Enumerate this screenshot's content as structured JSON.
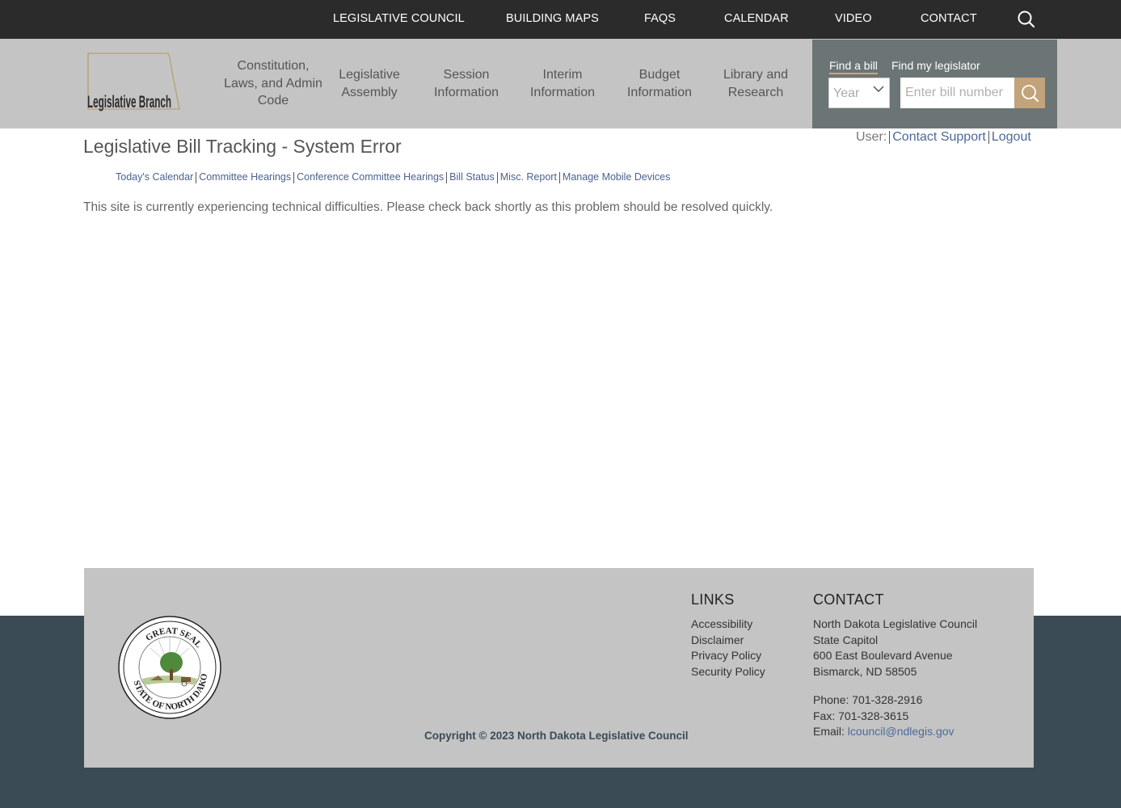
{
  "top_nav": {
    "items": [
      "LEGISLATIVE COUNCIL",
      "BUILDING MAPS",
      "FAQS",
      "CALENDAR",
      "VIDEO",
      "CONTACT"
    ],
    "search_icon": "search-icon"
  },
  "header": {
    "logo_text": "Legislative Branch",
    "main_nav": [
      {
        "line1": "Constitution,",
        "line2": "Laws, and Admin",
        "line3": "Code"
      },
      {
        "line1": "Legislative",
        "line2": "Assembly"
      },
      {
        "line1": "Session",
        "line2": "Information"
      },
      {
        "line1": "Interim",
        "line2": "Information"
      },
      {
        "line1": "Budget",
        "line2": "Information"
      },
      {
        "line1": "Library and",
        "line2": "Research"
      }
    ],
    "find_panel": {
      "tab_bill": "Find a bill",
      "tab_legislator": "Find my legislator",
      "year_value": "Year",
      "bill_placeholder": "Enter bill number",
      "accent": "#c2a37a"
    }
  },
  "page": {
    "title": "Legislative Bill Tracking - System Error",
    "user_label": "User:",
    "contact_support": "Contact Support",
    "logout": "Logout",
    "subnav": [
      "Today's Calendar",
      "Committee Hearings",
      "Conference Committee Hearings",
      "Bill Status",
      "Misc. Report",
      "Manage Mobile Devices"
    ],
    "error_message": "This site is currently experiencing technical difficulties. Please check back shortly as this problem should be resolved quickly."
  },
  "footer": {
    "seal_label": "great-seal-of-north-dakota",
    "copyright": "Copyright © 2023 North Dakota Legislative Council",
    "links_title": "LINKS",
    "links": [
      "Accessibility",
      "Disclaimer",
      "Privacy Policy",
      "Security Policy"
    ],
    "contact_title": "CONTACT",
    "address": [
      "North Dakota Legislative Council",
      "State Capitol",
      "600 East Boulevard Avenue",
      "Bismarck, ND  58505"
    ],
    "phone": "Phone: 701-328-2916",
    "fax": "Fax: 701-328-3615",
    "email_label": "Email: ",
    "email": "lcouncil@ndlegis.gov"
  }
}
